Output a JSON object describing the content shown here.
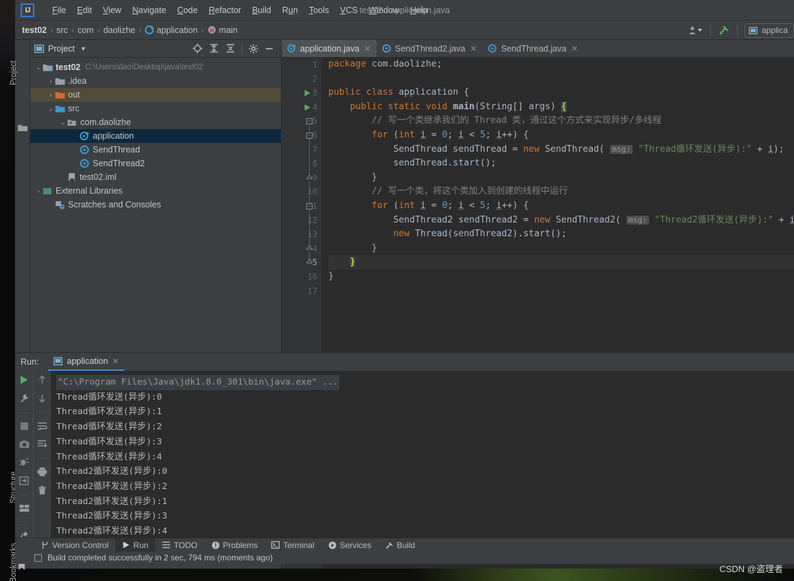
{
  "window": {
    "title": "test02 - application.java",
    "logo_text": "IJ"
  },
  "menubar": {
    "items": [
      {
        "label": "File"
      },
      {
        "label": "Edit"
      },
      {
        "label": "View"
      },
      {
        "label": "Navigate"
      },
      {
        "label": "Code"
      },
      {
        "label": "Refactor"
      },
      {
        "label": "Build"
      },
      {
        "label": "Run"
      },
      {
        "label": "Tools"
      },
      {
        "label": "VCS"
      },
      {
        "label": "Window"
      },
      {
        "label": "Help"
      }
    ]
  },
  "breadcrumb": {
    "items": [
      "test02",
      "src",
      "com",
      "daolizhe",
      "application",
      "main"
    ],
    "separator": "›"
  },
  "toolbar_right": {
    "run_config_label": "applica"
  },
  "project_panel": {
    "title": "Project",
    "vertical_tabs": [
      "Project",
      "Structure",
      "Bookmarks"
    ],
    "tree": [
      {
        "depth": 0,
        "arrow": "⌄",
        "label": "test02",
        "path": "C:\\Users\\dao\\Desktop\\java\\test02",
        "icon": "module-folder-icon",
        "bold": true,
        "state": "none"
      },
      {
        "depth": 1,
        "arrow": "›",
        "label": ".idea",
        "path": "",
        "icon": "folder-icon",
        "bold": false,
        "state": "none"
      },
      {
        "depth": 1,
        "arrow": "›",
        "label": "out",
        "path": "",
        "icon": "folder-orange-icon",
        "bold": false,
        "state": "highlight"
      },
      {
        "depth": 1,
        "arrow": "⌄",
        "label": "src",
        "path": "",
        "icon": "folder-source-icon",
        "bold": false,
        "state": "none"
      },
      {
        "depth": 2,
        "arrow": "⌄",
        "label": "com.daolizhe",
        "path": "",
        "icon": "package-icon",
        "bold": false,
        "state": "none"
      },
      {
        "depth": 3,
        "arrow": "",
        "label": "application",
        "path": "",
        "icon": "class-run-icon",
        "bold": false,
        "state": "selected"
      },
      {
        "depth": 3,
        "arrow": "",
        "label": "SendThread",
        "path": "",
        "icon": "class-icon",
        "bold": false,
        "state": "none"
      },
      {
        "depth": 3,
        "arrow": "",
        "label": "SendThread2",
        "path": "",
        "icon": "class-icon",
        "bold": false,
        "state": "none"
      },
      {
        "depth": 2,
        "arrow": "",
        "label": "test02.iml",
        "path": "",
        "icon": "iml-file-icon",
        "bold": false,
        "state": "none"
      },
      {
        "depth": 0,
        "arrow": "›",
        "label": "External Libraries",
        "path": "",
        "icon": "libraries-icon",
        "bold": false,
        "state": "none"
      },
      {
        "depth": 0,
        "arrow": "",
        "label": "Scratches and Consoles",
        "path": "",
        "icon": "scratches-icon",
        "bold": false,
        "state": "none"
      }
    ]
  },
  "editor": {
    "tabs": [
      {
        "label": "application.java",
        "icon": "java-class-run-icon",
        "active": true
      },
      {
        "label": "SendThread2.java",
        "icon": "java-class-icon",
        "active": false
      },
      {
        "label": "SendThread.java",
        "icon": "java-class-icon",
        "active": false
      }
    ],
    "line_count": 17,
    "cursor_line": 15,
    "lines": [
      {
        "n": 1,
        "tokens": [
          {
            "t": "package ",
            "c": "kw"
          },
          {
            "t": "com.daolizhe;",
            "c": ""
          }
        ]
      },
      {
        "n": 2,
        "tokens": []
      },
      {
        "n": 3,
        "gutter_icon": "run-triangle-icon",
        "tokens": [
          {
            "t": "public class ",
            "c": "kw"
          },
          {
            "t": "application {",
            "c": ""
          }
        ]
      },
      {
        "n": 4,
        "gutter_icon": "run-triangle-icon",
        "tokens": [
          {
            "t": "    public static void ",
            "c": "kw"
          },
          {
            "t": "main",
            "c": "bold"
          },
          {
            "t": "(String[] args) ",
            "c": ""
          },
          {
            "t": "{",
            "c": "brace"
          }
        ]
      },
      {
        "n": 5,
        "tokens": [
          {
            "t": "        // 写一个类继承我们的 Thread 类，通过这个方式来实现异步/多线程",
            "c": "cmt"
          }
        ]
      },
      {
        "n": 6,
        "tokens": [
          {
            "t": "        ",
            "c": ""
          },
          {
            "t": "for ",
            "c": "kw"
          },
          {
            "t": "(",
            "c": ""
          },
          {
            "t": "int ",
            "c": "kw"
          },
          {
            "t": "i",
            "c": "var"
          },
          {
            "t": " = ",
            "c": ""
          },
          {
            "t": "0",
            "c": "num"
          },
          {
            "t": "; ",
            "c": ""
          },
          {
            "t": "i",
            "c": "var"
          },
          {
            "t": " < ",
            "c": ""
          },
          {
            "t": "5",
            "c": "num"
          },
          {
            "t": "; ",
            "c": ""
          },
          {
            "t": "i",
            "c": "var"
          },
          {
            "t": "++) {",
            "c": ""
          }
        ]
      },
      {
        "n": 7,
        "tokens": [
          {
            "t": "            SendThread sendThread = ",
            "c": ""
          },
          {
            "t": "new ",
            "c": "kw"
          },
          {
            "t": "SendThread( ",
            "c": ""
          },
          {
            "t": "msg:",
            "c": "hint"
          },
          {
            "t": " ",
            "c": ""
          },
          {
            "t": "\"Thread循环发送(异步):\"",
            "c": "str"
          },
          {
            "t": " + ",
            "c": ""
          },
          {
            "t": "i",
            "c": "var"
          },
          {
            "t": ");",
            "c": ""
          }
        ]
      },
      {
        "n": 8,
        "tokens": [
          {
            "t": "            sendThread.start();",
            "c": ""
          }
        ]
      },
      {
        "n": 9,
        "tokens": [
          {
            "t": "        }",
            "c": ""
          }
        ]
      },
      {
        "n": 10,
        "tokens": [
          {
            "t": "        // 写一个类，将这个类加入到创建的线程中运行",
            "c": "cmt"
          }
        ]
      },
      {
        "n": 11,
        "tokens": [
          {
            "t": "        ",
            "c": ""
          },
          {
            "t": "for ",
            "c": "kw"
          },
          {
            "t": "(",
            "c": ""
          },
          {
            "t": "int ",
            "c": "kw"
          },
          {
            "t": "i",
            "c": "var"
          },
          {
            "t": " = ",
            "c": ""
          },
          {
            "t": "0",
            "c": "num"
          },
          {
            "t": "; ",
            "c": ""
          },
          {
            "t": "i",
            "c": "var"
          },
          {
            "t": " < ",
            "c": ""
          },
          {
            "t": "5",
            "c": "num"
          },
          {
            "t": "; ",
            "c": ""
          },
          {
            "t": "i",
            "c": "var"
          },
          {
            "t": "++) {",
            "c": ""
          }
        ]
      },
      {
        "n": 12,
        "tokens": [
          {
            "t": "            SendThread2 sendThread2 = ",
            "c": ""
          },
          {
            "t": "new ",
            "c": "kw"
          },
          {
            "t": "SendThread2( ",
            "c": ""
          },
          {
            "t": "msg:",
            "c": "hint"
          },
          {
            "t": " ",
            "c": ""
          },
          {
            "t": "\"Thread2循环发送(异步):\"",
            "c": "str"
          },
          {
            "t": " + ",
            "c": ""
          },
          {
            "t": "i",
            "c": "var"
          },
          {
            "t": ");",
            "c": ""
          }
        ]
      },
      {
        "n": 13,
        "tokens": [
          {
            "t": "            ",
            "c": ""
          },
          {
            "t": "new ",
            "c": "kw"
          },
          {
            "t": "Thread(sendThread2).start();",
            "c": ""
          }
        ]
      },
      {
        "n": 14,
        "tokens": [
          {
            "t": "        }",
            "c": ""
          }
        ]
      },
      {
        "n": 15,
        "tokens": [
          {
            "t": "    ",
            "c": ""
          },
          {
            "t": "}",
            "c": "brace"
          }
        ]
      },
      {
        "n": 16,
        "tokens": [
          {
            "t": "}",
            "c": ""
          }
        ]
      },
      {
        "n": 17,
        "tokens": []
      }
    ]
  },
  "run_window": {
    "label": "Run:",
    "tab_label": "application",
    "console_command": "\"C:\\Program Files\\Java\\jdk1.8.0_301\\bin\\java.exe\" ...",
    "console_lines": [
      "Thread循环发送(异步):0",
      "Thread循环发送(异步):1",
      "Thread循环发送(异步):2",
      "Thread循环发送(异步):3",
      "Thread循环发送(异步):4",
      "Thread2循环发送(异步):0",
      "Thread2循环发送(异步):2",
      "Thread2循环发送(异步):1",
      "Thread2循环发送(异步):3",
      "Thread2循环发送(异步):4"
    ],
    "left_tools": [
      "run-icon",
      "wrench-icon",
      "stop-icon",
      "camera-icon",
      "debug-icon",
      "rerun-icon",
      "layout-icon",
      "pin-icon"
    ],
    "right_tools": [
      "arrow-up-icon",
      "arrow-down-icon",
      "soft-wrap-icon",
      "scroll-end-icon",
      "print-icon",
      "trash-icon"
    ]
  },
  "bottom_bar": {
    "items": [
      {
        "label": "Version Control",
        "icon": "branch-icon",
        "active": false
      },
      {
        "label": "Run",
        "icon": "run-icon",
        "active": true
      },
      {
        "label": "TODO",
        "icon": "list-icon",
        "active": false
      },
      {
        "label": "Problems",
        "icon": "exclamation-icon",
        "active": false
      },
      {
        "label": "Terminal",
        "icon": "terminal-icon",
        "active": false
      },
      {
        "label": "Services",
        "icon": "services-icon",
        "active": false
      },
      {
        "label": "Build",
        "icon": "hammer-icon",
        "active": false
      }
    ]
  },
  "status_bar": {
    "message": "Build completed successfully in 2 sec, 794 ms (moments ago)"
  },
  "watermark": {
    "text": "CSDN @盗理者"
  },
  "colors": {
    "panel_bg": "#3c3f41",
    "editor_bg": "#2b2b2b",
    "gutter_bg": "#313335",
    "selection_blue": "#0d293e",
    "keyword_orange": "#cc7832",
    "string_green": "#6a8759",
    "number_blue": "#6897bb",
    "comment_gray": "#808080",
    "accent_tab": "#4a88c7"
  }
}
